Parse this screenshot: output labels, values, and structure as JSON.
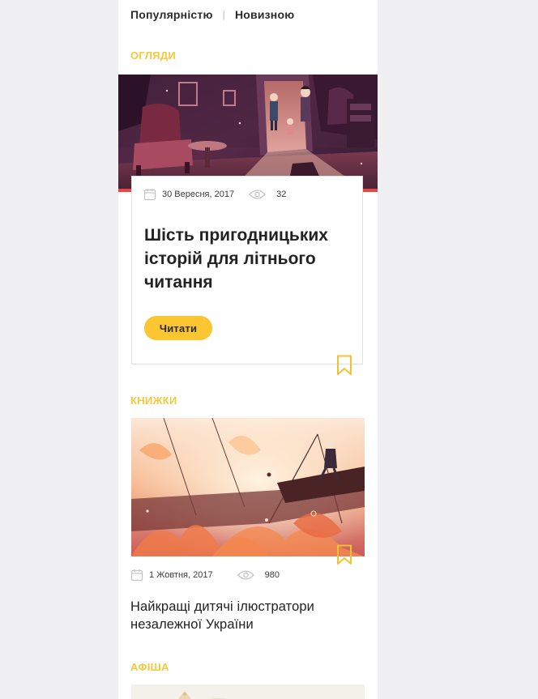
{
  "sort": {
    "popular": "Популярністю",
    "separator": "|",
    "newest": "Новизною"
  },
  "sections": {
    "reviews": "ОГЛЯДИ",
    "books": "КНИЖКИ",
    "afisha": "АФІША"
  },
  "review_card": {
    "date": "30 Вересня, 2017",
    "views": "32",
    "title": "Шість пригодницьких історій для літнього читання",
    "read_label": "Читати"
  },
  "books_card": {
    "date": "1 Жовтня, 2017",
    "views": "980",
    "title": "Найкращі дитячі ілюстратори незалежної України"
  },
  "colors": {
    "accent_yellow": "#fbc632",
    "section_label": "#f7c83b",
    "red_strip": "#e94545"
  },
  "icons": {
    "date": "calendar-icon",
    "views": "eye-icon",
    "save": "bookmark-icon"
  }
}
